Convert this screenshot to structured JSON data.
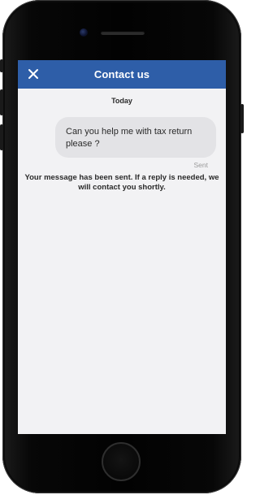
{
  "header": {
    "title": "Contact us",
    "close_icon": "close-icon",
    "background_color": "#2e5ea8",
    "text_color": "#ffffff"
  },
  "conversation": {
    "date_label": "Today",
    "messages": [
      {
        "text": "Can you help me with tax return please ?",
        "status": "Sent"
      }
    ],
    "system_message": "Your message has been sent. If a reply is needed, we will contact you shortly."
  },
  "colors": {
    "screen_background": "#f2f2f4",
    "bubble_background": "#e3e3e6",
    "status_text": "#9a9a9a"
  }
}
